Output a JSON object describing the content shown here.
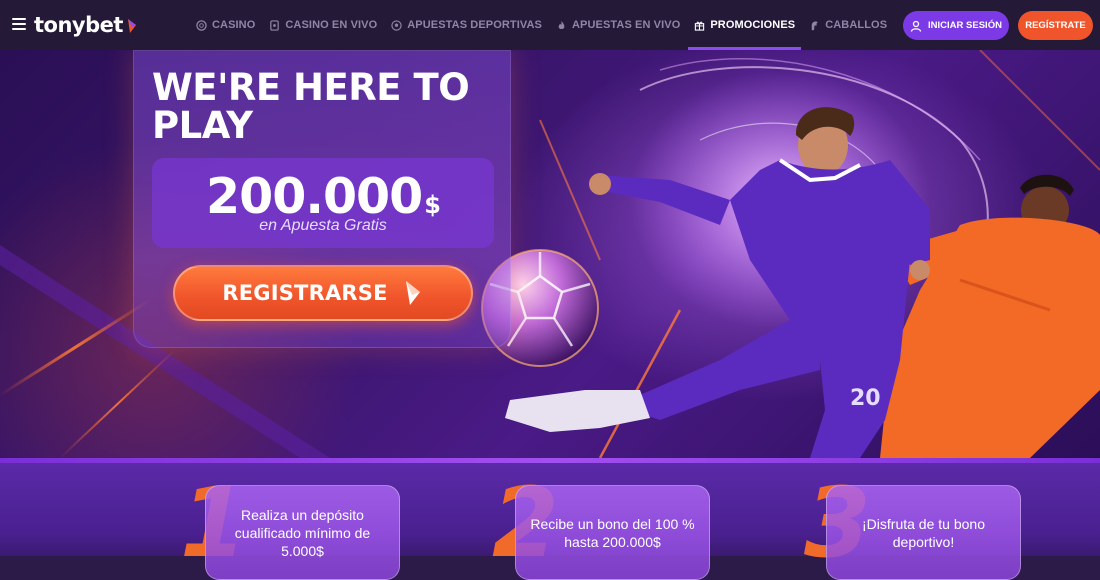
{
  "header": {
    "logo_text": "tonybet",
    "nav": [
      {
        "label": "CASINO",
        "icon": "casino-chip-icon",
        "active": false
      },
      {
        "label": "CASINO EN VIVO",
        "icon": "live-casino-icon",
        "active": false
      },
      {
        "label": "APUESTAS DEPORTIVAS",
        "icon": "soccer-ball-icon",
        "active": false
      },
      {
        "label": "APUESTAS EN VIVO",
        "icon": "live-flame-icon",
        "active": false
      },
      {
        "label": "PROMOCIONES",
        "icon": "gift-icon",
        "active": true
      },
      {
        "label": "CABALLOS",
        "icon": "horse-icon",
        "active": false
      }
    ],
    "login_label": "INICIAR SESIÓN",
    "register_label": "REGÍSTRATE"
  },
  "hero": {
    "title": "WE'RE HERE TO PLAY",
    "amount": "200.000",
    "currency": "$",
    "amount_subtitle": "en Apuesta Gratis",
    "cta_label": "REGISTRARSE"
  },
  "steps": [
    {
      "number": "1",
      "text": "Realiza un depósito cualificado mínimo de 5.000$"
    },
    {
      "number": "2",
      "text": "Recibe un bono del 100 % hasta 200.000$"
    },
    {
      "number": "3",
      "text": "¡Disfruta de tu bono deportivo!"
    }
  ],
  "colors": {
    "accent_purple": "#7c3ae6",
    "accent_orange": "#f0542b",
    "header_bg": "#241a38"
  }
}
